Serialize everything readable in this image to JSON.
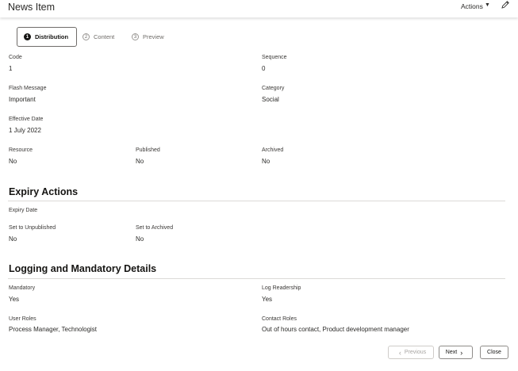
{
  "header": {
    "title": "News Item",
    "actions_label": "Actions"
  },
  "train": {
    "steps": [
      {
        "num": "1",
        "label": "Distribution"
      },
      {
        "num": "2",
        "label": "Content"
      },
      {
        "num": "3",
        "label": "Preview"
      }
    ]
  },
  "fields": {
    "code": {
      "label": "Code",
      "value": "1"
    },
    "sequence": {
      "label": "Sequence",
      "value": "0"
    },
    "flash_message": {
      "label": "Flash Message",
      "value": "Important"
    },
    "category": {
      "label": "Category",
      "value": "Social"
    },
    "effective_date": {
      "label": "Effective Date",
      "value": "1 July 2022"
    },
    "resource": {
      "label": "Resource",
      "value": "No"
    },
    "published": {
      "label": "Published",
      "value": "No"
    },
    "archived": {
      "label": "Archived",
      "value": "No"
    }
  },
  "expiry": {
    "heading": "Expiry Actions",
    "expiry_date_label": "Expiry Date",
    "set_unpublished": {
      "label": "Set to Unpublished",
      "value": "No"
    },
    "set_archived": {
      "label": "Set to Archived",
      "value": "No"
    }
  },
  "logging": {
    "heading": "Logging and Mandatory Details",
    "mandatory": {
      "label": "Mandatory",
      "value": "Yes"
    },
    "log_readership": {
      "label": "Log Readership",
      "value": "Yes"
    },
    "user_roles": {
      "label": "User Roles",
      "value": "Process Manager, Technologist"
    },
    "contact_roles": {
      "label": "Contact Roles",
      "value": "Out of hours contact, Product development manager"
    }
  },
  "footer": {
    "previous_label": "Previous",
    "next_label": "Next",
    "close_label": "Close"
  }
}
